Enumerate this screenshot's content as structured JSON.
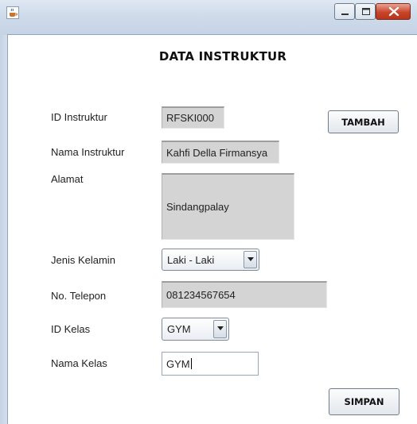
{
  "window": {
    "icon": "java-cup-icon",
    "controls": [
      "minimize-icon",
      "maximize-icon",
      "close-icon"
    ]
  },
  "form": {
    "title": "DATA INSTRUKTUR",
    "id_instruktur": {
      "label": "ID Instruktur",
      "value": "RFSKI000"
    },
    "nama_instruktur": {
      "label": "Nama Instruktur",
      "value": "Kahfi Della Firmansya"
    },
    "alamat": {
      "label": "Alamat",
      "value": "Sindangpalay"
    },
    "jenis_kelamin": {
      "label": "Jenis Kelamin",
      "selected": "Laki - Laki"
    },
    "no_telepon": {
      "label": "No. Telepon",
      "value": "081234567654"
    },
    "id_kelas": {
      "label": "ID Kelas",
      "selected": "GYM"
    },
    "nama_kelas": {
      "label": "Nama Kelas",
      "value": "GYM"
    },
    "tambah_label": "TAMBAH",
    "simpan_label": "SIMPAN"
  }
}
